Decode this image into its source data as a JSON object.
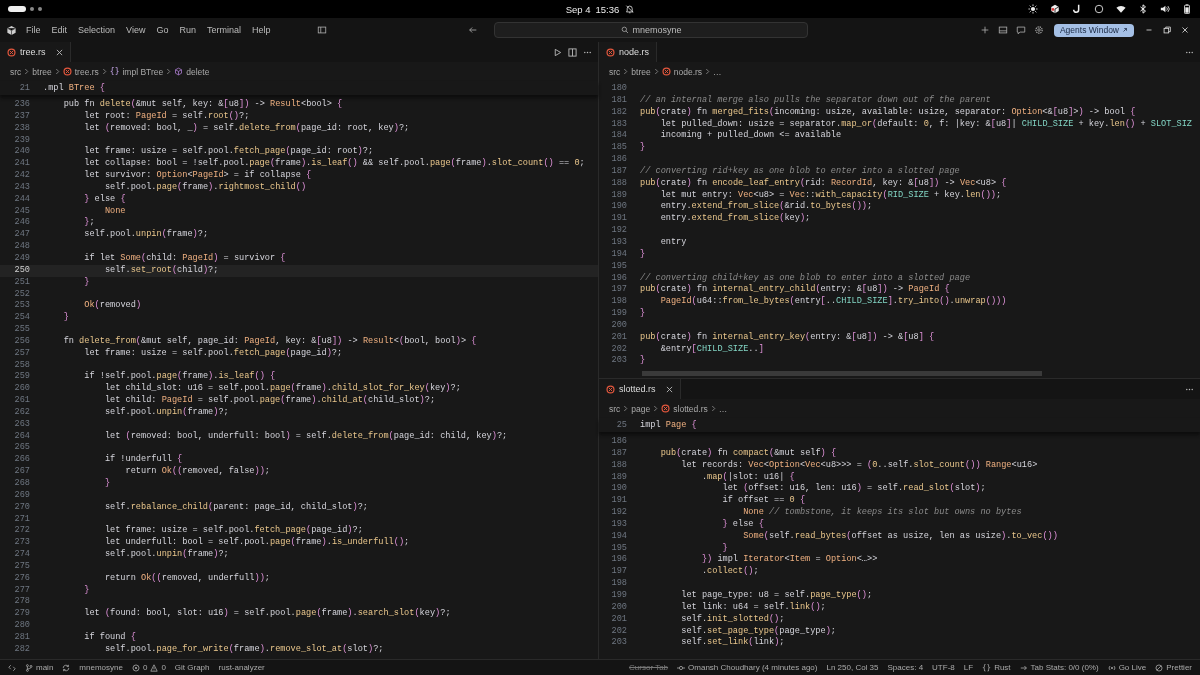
{
  "system_bar": {
    "date": "Sep 4",
    "time": "15:36"
  },
  "menu": [
    "File",
    "Edit",
    "Selection",
    "View",
    "Go",
    "Run",
    "Terminal",
    "Help"
  ],
  "search": {
    "value": "mnemosyne"
  },
  "agents_button": "Agents Window",
  "panes": [
    {
      "tab": {
        "label": "tree.rs",
        "close_button": true
      },
      "actions": true,
      "breadcrumb": [
        {
          "label": "src",
          "kind": "folder"
        },
        {
          "label": "btree",
          "kind": "folder"
        },
        {
          "label": "tree.rs",
          "kind": "file"
        },
        {
          "label": "impl BTree",
          "kind": "impl",
          "glyph": "{}"
        },
        {
          "label": "delete",
          "kind": "method"
        }
      ],
      "sticky": {
        "n": "21",
        "code": ".mpl BTree {"
      },
      "lines": [
        {
          "n": "236",
          "current": false,
          "code": "    pub fn delete(&mut self, key: &[u8]) -> Result<bool> {"
        },
        {
          "n": "237",
          "current": false,
          "code": "        let root: PageId = self.root()?;"
        },
        {
          "n": "238",
          "current": false,
          "code": "        let (removed: bool, _) = self.delete_from(page_id: root, key)?;"
        },
        {
          "n": "239",
          "current": false
        },
        {
          "n": "240",
          "current": false,
          "code": "        let frame: usize = self.pool.fetch_page(page_id: root)?;"
        },
        {
          "n": "241",
          "current": false,
          "code": "        let collapse: bool = !self.pool.page(frame).is_leaf() && self.pool.page(frame).slot_count() == 0;"
        },
        {
          "n": "242",
          "current": false,
          "code": "        let survivor: Option<PageId> = if collapse {"
        },
        {
          "n": "243",
          "current": false,
          "code": "            self.pool.page(frame).rightmost_child()"
        },
        {
          "n": "244",
          "current": false,
          "code": "        } else {"
        },
        {
          "n": "245",
          "current": false,
          "code": "            None"
        },
        {
          "n": "246",
          "current": false,
          "code": "        };"
        },
        {
          "n": "247",
          "current": false,
          "code": "        self.pool.unpin(frame)?;"
        },
        {
          "n": "248",
          "current": false
        },
        {
          "n": "249",
          "current": false,
          "code": "        if let Some(child: PageId) = survivor {"
        },
        {
          "n": "250",
          "current": true,
          "code": "            self.set_root(child)?;"
        },
        {
          "n": "251",
          "current": false,
          "code": "        }"
        },
        {
          "n": "252",
          "current": false
        },
        {
          "n": "253",
          "current": false,
          "code": "        Ok(removed)"
        },
        {
          "n": "254",
          "current": false,
          "code": "    }"
        },
        {
          "n": "255",
          "current": false
        },
        {
          "n": "256",
          "current": false,
          "code": "    fn delete_from(&mut self, page_id: PageId, key: &[u8]) -> Result<(bool, bool)> {"
        },
        {
          "n": "257",
          "current": false,
          "code": "        let frame: usize = self.pool.fetch_page(page_id)?;"
        },
        {
          "n": "258",
          "current": false
        },
        {
          "n": "259",
          "current": false,
          "code": "        if !self.pool.page(frame).is_leaf() {"
        },
        {
          "n": "260",
          "current": false,
          "code": "            let child_slot: u16 = self.pool.page(frame).child_slot_for_key(key)?;"
        },
        {
          "n": "261",
          "current": false,
          "code": "            let child: PageId = self.pool.page(frame).child_at(child_slot)?;"
        },
        {
          "n": "262",
          "current": false,
          "code": "            self.pool.unpin(frame)?;"
        },
        {
          "n": "263",
          "current": false
        },
        {
          "n": "264",
          "current": false,
          "code": "            let (removed: bool, underfull: bool) = self.delete_from(page_id: child, key)?;"
        },
        {
          "n": "265",
          "current": false
        },
        {
          "n": "266",
          "current": false,
          "code": "            if !underfull {"
        },
        {
          "n": "267",
          "current": false,
          "code": "                return Ok((removed, false));"
        },
        {
          "n": "268",
          "current": false,
          "code": "            }"
        },
        {
          "n": "269",
          "current": false
        },
        {
          "n": "270",
          "current": false,
          "code": "            self.rebalance_child(parent: page_id, child_slot)?;"
        },
        {
          "n": "271",
          "current": false
        },
        {
          "n": "272",
          "current": false,
          "code": "            let frame: usize = self.pool.fetch_page(page_id)?;"
        },
        {
          "n": "273",
          "current": false,
          "code": "            let underfull: bool = self.pool.page(frame).is_underfull();"
        },
        {
          "n": "274",
          "current": false,
          "code": "            self.pool.unpin(frame)?;"
        },
        {
          "n": "275",
          "current": false
        },
        {
          "n": "276",
          "current": false,
          "code": "            return Ok((removed, underfull));"
        },
        {
          "n": "277",
          "current": false,
          "code": "        }"
        },
        {
          "n": "278",
          "current": false
        },
        {
          "n": "279",
          "current": false,
          "code": "        let (found: bool, slot: u16) = self.pool.page(frame).search_slot(key)?;"
        },
        {
          "n": "280",
          "current": false
        },
        {
          "n": "281",
          "current": false,
          "code": "        if found {"
        },
        {
          "n": "282",
          "current": false,
          "code": "            self.pool.page_for_write(frame).remove_slot_at(slot)?;"
        }
      ]
    },
    {
      "tab": {
        "label": "node.rs",
        "close_button": false
      },
      "actions": false,
      "breadcrumb": [
        {
          "label": "src",
          "kind": "folder"
        },
        {
          "label": "btree",
          "kind": "folder"
        },
        {
          "label": "node.rs",
          "kind": "file"
        },
        {
          "label": "…",
          "kind": "folder"
        }
      ],
      "lines": [
        {
          "n": "180"
        },
        {
          "n": "181",
          "code": "// an internal merge also pulls the separator down out of the parent"
        },
        {
          "n": "182",
          "code": "pub(crate) fn merged_fits(incoming: usize, available: usize, separator: Option<&[u8]>) -> bool {"
        },
        {
          "n": "183",
          "code": "    let pulled_down: usize = separator.map_or(default: 0, f: |key: &[u8]| CHILD_SIZE + key.len() + SLOT_SIZ"
        },
        {
          "n": "184",
          "code": "    incoming + pulled_down <= available"
        },
        {
          "n": "185",
          "code": "}"
        },
        {
          "n": "186"
        },
        {
          "n": "187",
          "code": "// converting rid+key as one blob to enter into a slotted page"
        },
        {
          "n": "188",
          "code": "pub(crate) fn encode_leaf_entry(rid: RecordId, key: &[u8]) -> Vec<u8> {"
        },
        {
          "n": "189",
          "code": "    let mut entry: Vec<u8> = Vec::with_capacity(RID_SIZE + key.len());"
        },
        {
          "n": "190",
          "code": "    entry.extend_from_slice(&rid.to_bytes());"
        },
        {
          "n": "191",
          "code": "    entry.extend_from_slice(key);"
        },
        {
          "n": "192"
        },
        {
          "n": "193",
          "code": "    entry"
        },
        {
          "n": "194",
          "code": "}"
        },
        {
          "n": "195"
        },
        {
          "n": "196",
          "code": "// converting child+key as one blob to enter into a slotted page"
        },
        {
          "n": "197",
          "code": "pub(crate) fn internal_entry_child(entry: &[u8]) -> PageId {"
        },
        {
          "n": "198",
          "code": "    PageId(u64::from_le_bytes(entry[..CHILD_SIZE].try_into().unwrap()))"
        },
        {
          "n": "199",
          "code": "}"
        },
        {
          "n": "200"
        },
        {
          "n": "201",
          "code": "pub(crate) fn internal_entry_key(entry: &[u8]) -> &[u8] {"
        },
        {
          "n": "202",
          "code": "    &entry[CHILD_SIZE..]"
        },
        {
          "n": "203",
          "code": "}"
        }
      ]
    },
    {
      "tab": {
        "label": "slotted.rs",
        "close_button": true
      },
      "actions": false,
      "breadcrumb": [
        {
          "label": "src",
          "kind": "folder"
        },
        {
          "label": "page",
          "kind": "folder"
        },
        {
          "label": "slotted.rs",
          "kind": "file"
        },
        {
          "label": "…",
          "kind": "folder"
        }
      ],
      "sticky": {
        "n": "25",
        "code": "impl Page {"
      },
      "lines": [
        {
          "n": "186"
        },
        {
          "n": "187",
          "code": "    pub(crate) fn compact(&mut self) {"
        },
        {
          "n": "188",
          "code": "        let records: Vec<Option<Vec<u8>>> = (0..self.slot_count()) Range<u16>"
        },
        {
          "n": "189",
          "code": "            .map(|slot: u16| {"
        },
        {
          "n": "190",
          "code": "                let (offset: u16, len: u16) = self.read_slot(slot);"
        },
        {
          "n": "191",
          "code": "                if offset == 0 {"
        },
        {
          "n": "192",
          "code": "                    None // tombstone, it keeps its slot but owns no bytes"
        },
        {
          "n": "193",
          "code": "                } else {"
        },
        {
          "n": "194",
          "code": "                    Some(self.read_bytes(offset as usize, len as usize).to_vec())"
        },
        {
          "n": "195",
          "code": "                }"
        },
        {
          "n": "196",
          "code": "            }) impl Iterator<Item = Option<…>>"
        },
        {
          "n": "197",
          "code": "            .collect();"
        },
        {
          "n": "198"
        },
        {
          "n": "199",
          "code": "        let page_type: u8 = self.page_type();"
        },
        {
          "n": "200",
          "code": "        let link: u64 = self.link();"
        },
        {
          "n": "201",
          "code": "        self.init_slotted();"
        },
        {
          "n": "202",
          "code": "        self.set_page_type(page_type);"
        },
        {
          "n": "203",
          "code": "        self.set_link(link);"
        }
      ]
    }
  ],
  "status_bar": {
    "left": [
      {
        "kind": "remote"
      },
      {
        "kind": "branch",
        "label": "main"
      },
      {
        "kind": "sync"
      },
      {
        "kind": "text",
        "label": "mnemosyne"
      },
      {
        "kind": "problems",
        "errors": "0",
        "warnings": "0"
      },
      {
        "kind": "text",
        "label": "Git Graph"
      },
      {
        "kind": "text",
        "label": "rust-analyzer"
      }
    ],
    "right": [
      {
        "kind": "strike",
        "label": "Cursor Tab"
      },
      {
        "kind": "blame",
        "label": "Omansh Choudhary (4 minutes ago)"
      },
      {
        "kind": "text",
        "label": "Ln 250, Col 35"
      },
      {
        "kind": "text",
        "label": "Spaces: 4"
      },
      {
        "kind": "text",
        "label": "UTF-8"
      },
      {
        "kind": "text",
        "label": "LF"
      },
      {
        "kind": "language",
        "glyph": "{}",
        "label": "Rust"
      },
      {
        "kind": "stats",
        "label": "Tab Stats: 0/0 (0%)"
      },
      {
        "kind": "golive",
        "label": "Go Live"
      },
      {
        "kind": "prettier",
        "label": "Prettier"
      }
    ]
  }
}
